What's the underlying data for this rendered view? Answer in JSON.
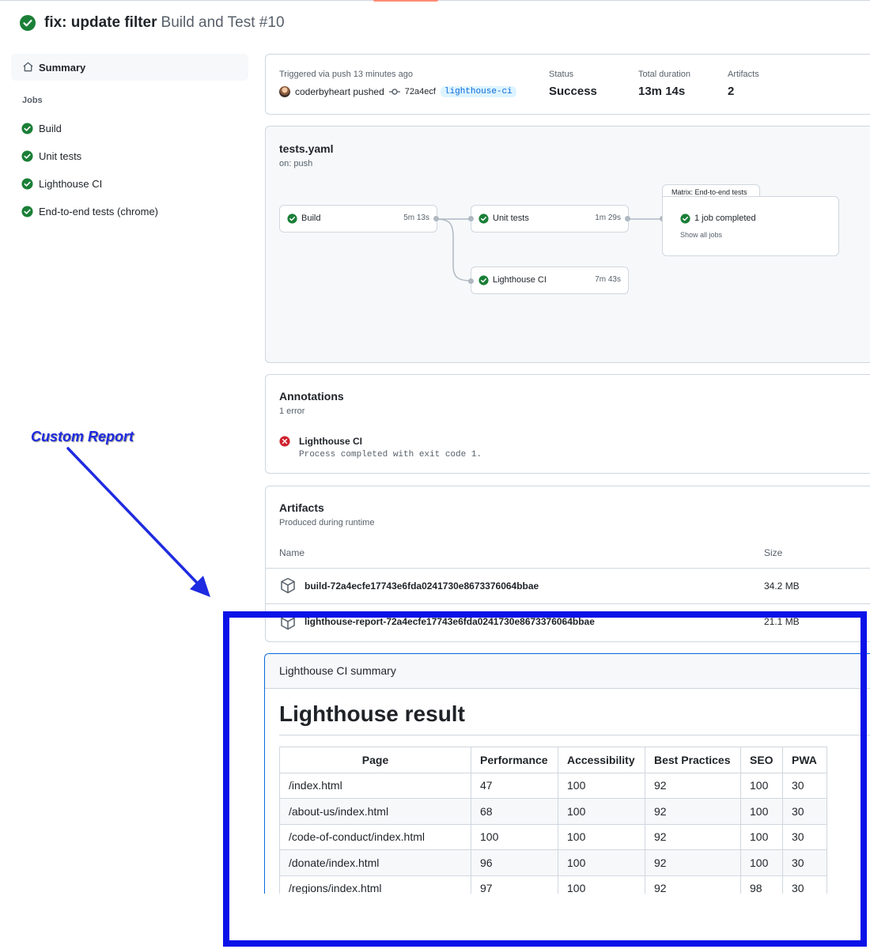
{
  "header": {
    "title_bold": "fix: update filter",
    "title_sub": "Build and Test #10"
  },
  "sidebar": {
    "summary_label": "Summary",
    "jobs_heading": "Jobs",
    "jobs": [
      {
        "label": "Build"
      },
      {
        "label": "Unit tests"
      },
      {
        "label": "Lighthouse CI"
      },
      {
        "label": "End-to-end tests (chrome)"
      }
    ]
  },
  "run_info": {
    "triggered": "Triggered via push 13 minutes ago",
    "user_text": "coderbyheart pushed",
    "commit": "72a4ecf",
    "branch": "lighthouse-ci",
    "status_label": "Status",
    "status_value": "Success",
    "duration_label": "Total duration",
    "duration_value": "13m 14s",
    "artifacts_label": "Artifacts",
    "artifacts_value": "2"
  },
  "workflow": {
    "file": "tests.yaml",
    "trigger": "on: push",
    "nodes": [
      {
        "name": "Build",
        "duration": "5m 13s"
      },
      {
        "name": "Unit tests",
        "duration": "1m 29s"
      },
      {
        "name": "Lighthouse CI",
        "duration": "7m 43s"
      }
    ],
    "matrix_label": "Matrix: End-to-end tests",
    "matrix_status": "1 job completed",
    "matrix_link": "Show all jobs"
  },
  "annotations": {
    "title": "Annotations",
    "count": "1 error",
    "item_title": "Lighthouse CI",
    "item_message": "Process completed with exit code 1."
  },
  "artifacts": {
    "title": "Artifacts",
    "subtitle": "Produced during runtime",
    "col_name": "Name",
    "col_size": "Size",
    "rows": [
      {
        "name": "build-72a4ecfe17743e6fda0241730e8673376064bbae",
        "size": "34.2 MB"
      },
      {
        "name": "lighthouse-report-72a4ecfe17743e6fda0241730e8673376064bbae",
        "size": "21.1 MB"
      }
    ]
  },
  "report": {
    "header": "Lighthouse CI summary",
    "title": "Lighthouse result",
    "columns": [
      "Page",
      "Performance",
      "Accessibility",
      "Best Practices",
      "SEO",
      "PWA"
    ],
    "rows": [
      [
        "/index.html",
        "47",
        "100",
        "92",
        "100",
        "30"
      ],
      [
        "/about-us/index.html",
        "68",
        "100",
        "92",
        "100",
        "30"
      ],
      [
        "/code-of-conduct/index.html",
        "100",
        "100",
        "92",
        "100",
        "30"
      ],
      [
        "/donate/index.html",
        "96",
        "100",
        "92",
        "100",
        "30"
      ],
      [
        "/regions/index.html",
        "97",
        "100",
        "92",
        "98",
        "30"
      ]
    ]
  },
  "overlay": {
    "callout": "Custom Report"
  },
  "colors": {
    "success": "#1a7f37",
    "error": "#cf222e",
    "overlay_blue": "#0b12e8"
  }
}
